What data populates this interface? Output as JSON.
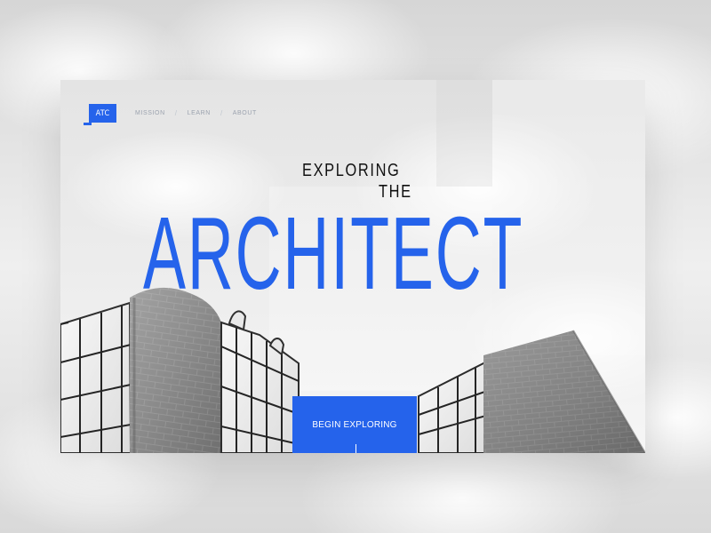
{
  "brand": {
    "logo_text": "ATC"
  },
  "nav": {
    "items": [
      {
        "label": "MISSION"
      },
      {
        "label": "LEARN"
      },
      {
        "label": "ABOUT"
      }
    ],
    "separator": "/"
  },
  "hero": {
    "line1": "EXPLORING",
    "line2": "THE",
    "title": "ARCHITECT",
    "cta_label": "BEGIN EXPLORING"
  },
  "colors": {
    "accent": "#2563eb",
    "text_dark": "#111111",
    "nav_text": "#9ca3af"
  }
}
